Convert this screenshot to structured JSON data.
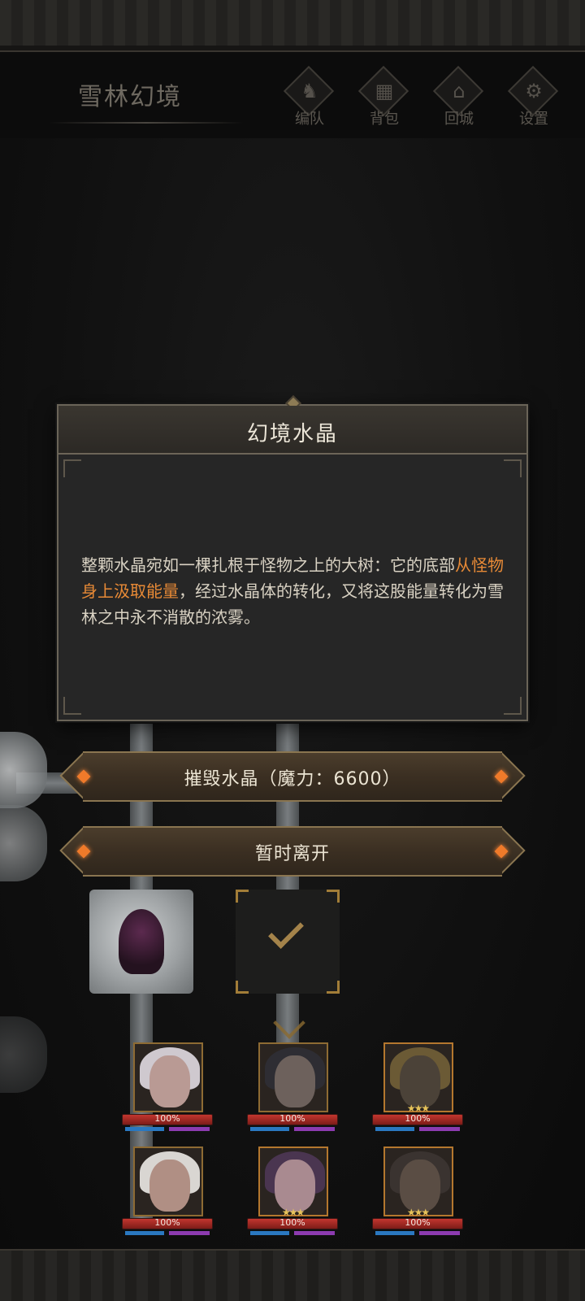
{
  "header": {
    "map_title": "雪林幻境",
    "nav": [
      {
        "label": "编队",
        "icon": "team-icon"
      },
      {
        "label": "背包",
        "icon": "backpack-icon"
      },
      {
        "label": "回城",
        "icon": "return-city-icon"
      },
      {
        "label": "设置",
        "icon": "gear-icon"
      }
    ]
  },
  "dialog": {
    "title": "幻境水晶",
    "body_part1": "整颗水晶宛如一棵扎根于怪物之上的大树：它的底部",
    "body_highlight": "从怪物身上汲取能量",
    "body_part2": "，经过水晶体的转化，又将这股能量转化为雪林之中永不消散的浓雾。",
    "highlight_color": "#e88a36"
  },
  "actions": {
    "destroy_label": "摧毁水晶（魔力：6600）",
    "leave_label": "暂时离开"
  },
  "party": [
    {
      "hp": "100%",
      "stars": ""
    },
    {
      "hp": "100%",
      "stars": ""
    },
    {
      "hp": "100%",
      "stars": "★★★"
    },
    {
      "hp": "100%",
      "stars": ""
    },
    {
      "hp": "100%",
      "stars": "★★★"
    },
    {
      "hp": "100%",
      "stars": "★★★"
    }
  ]
}
